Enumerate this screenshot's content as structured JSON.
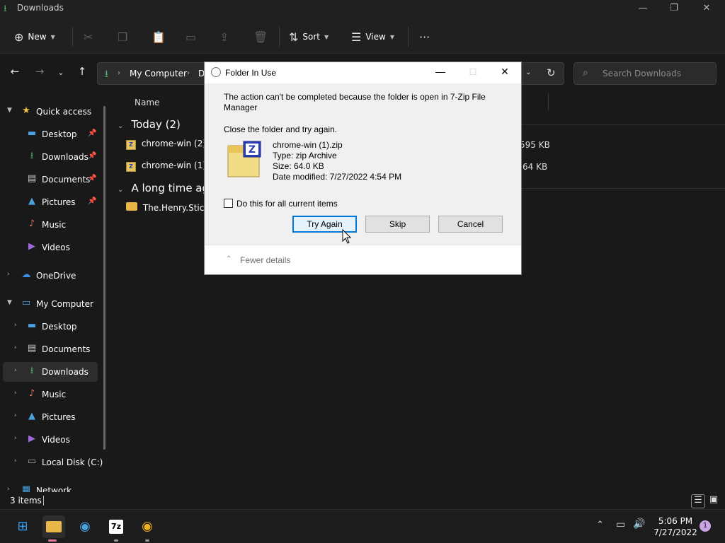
{
  "window": {
    "title": "Downloads"
  },
  "toolbar": {
    "new_label": "New",
    "sort_label": "Sort",
    "view_label": "View",
    "more_label": "···"
  },
  "address": {
    "crumbs": [
      "My Computer",
      "D"
    ],
    "search_placeholder": "Search Downloads"
  },
  "sidebar": {
    "quick_access": "Quick access",
    "quick_items": [
      {
        "label": "Desktop",
        "icon": "desktop-icon",
        "pinned": true
      },
      {
        "label": "Downloads",
        "icon": "download-icon",
        "pinned": true
      },
      {
        "label": "Documents",
        "icon": "document-icon",
        "pinned": true
      },
      {
        "label": "Pictures",
        "icon": "picture-icon",
        "pinned": true
      },
      {
        "label": "Music",
        "icon": "music-icon",
        "pinned": false
      },
      {
        "label": "Videos",
        "icon": "video-icon",
        "pinned": false
      }
    ],
    "onedrive": "OneDrive",
    "my_computer": "My Computer",
    "computer_items": [
      {
        "label": "Desktop",
        "icon": "desktop-icon"
      },
      {
        "label": "Documents",
        "icon": "document-icon"
      },
      {
        "label": "Downloads",
        "icon": "download-icon",
        "selected": true
      },
      {
        "label": "Music",
        "icon": "music-icon"
      },
      {
        "label": "Pictures",
        "icon": "picture-icon"
      },
      {
        "label": "Videos",
        "icon": "video-icon"
      },
      {
        "label": "Local Disk (C:)",
        "icon": "drive-icon"
      }
    ],
    "network": "Network"
  },
  "content": {
    "column_name": "Name",
    "groups": [
      {
        "title": "Today (2)",
        "files": [
          {
            "name": "chrome-win (2).z",
            "size": "595 KB"
          },
          {
            "name": "chrome-win (1).z",
            "size": "64 KB"
          }
        ]
      },
      {
        "title": "A long time ago",
        "files": [
          {
            "name": "The.Henry.Stickm",
            "size": ""
          }
        ]
      }
    ]
  },
  "status": {
    "item_count": "3 items"
  },
  "taskbar": {
    "time": "5:06 PM",
    "date": "7/27/2022",
    "notification_count": "1",
    "sevenzip_label": "7z"
  },
  "dialog": {
    "title": "Folder In Use",
    "message": "The action can't be completed because the folder is open in 7-Zip File Manager",
    "instruction": "Close the folder and try again.",
    "file": {
      "name": "chrome-win (1).zip",
      "type": "Type: zip Archive",
      "size": "Size: 64.0 KB",
      "modified": "Date modified: 7/27/2022 4:54 PM"
    },
    "checkbox_label": "Do this for all current items",
    "buttons": {
      "try_again": "Try Again",
      "skip": "Skip",
      "cancel": "Cancel"
    },
    "fewer_details": "Fewer details"
  },
  "colors": {
    "accent": "#0078d7",
    "explorer_bg": "#191919",
    "folder": "#e8b646"
  }
}
